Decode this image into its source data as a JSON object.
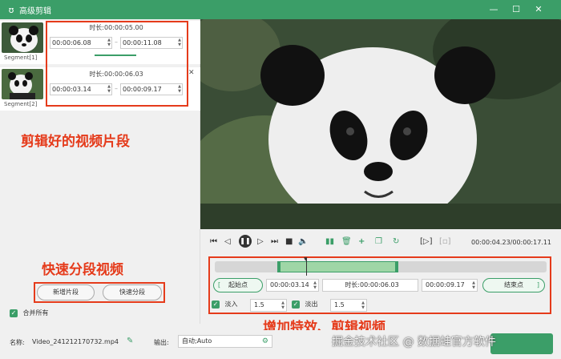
{
  "window": {
    "title": "高级剪辑",
    "minimize": "—",
    "maximize": "☐",
    "close": "✕"
  },
  "segments": [
    {
      "label": "Segment[1]",
      "duration_label": "时长:",
      "duration": "00:00:05.00",
      "start": "00:00:06.08",
      "end": "00:00:11.08"
    },
    {
      "label": "Segment[2]",
      "duration_label": "时长:",
      "duration": "00:00:06.03",
      "start": "00:00:03.14",
      "end": "00:00:09.17"
    }
  ],
  "segment_close": "✕",
  "annotations": {
    "clips": "剪辑好的视频片段",
    "split": "快速分段视频",
    "effects": "增加特效、剪辑视频"
  },
  "buttons": {
    "add_segment": "新增片段",
    "quick_split": "快速分段"
  },
  "merge_all": "合并所有",
  "player": {
    "time": "00:00:04.23/00:00:17.11"
  },
  "trim": {
    "start_btn": "起始点",
    "start_time": "00:00:03.14",
    "duration_label": "时长:",
    "duration": "00:00:06.03",
    "end_time": "00:00:09.17",
    "end_btn": "结束点",
    "bracket_open": "[",
    "bracket_close": "]",
    "fade_in_label": "淡入",
    "fade_in_value": "1.5",
    "fade_out_label": "淡出",
    "fade_out_value": "1.5"
  },
  "bottom": {
    "name_label": "名称:",
    "file_name": "Video_241212170732.mp4",
    "output_label": "输出:",
    "output_value": "自动;Auto"
  },
  "watermark": "掘金技术社区 @ 数据蛙官方软件",
  "colors": {
    "accent": "#3b9e68",
    "annotation": "#e53b1b"
  }
}
